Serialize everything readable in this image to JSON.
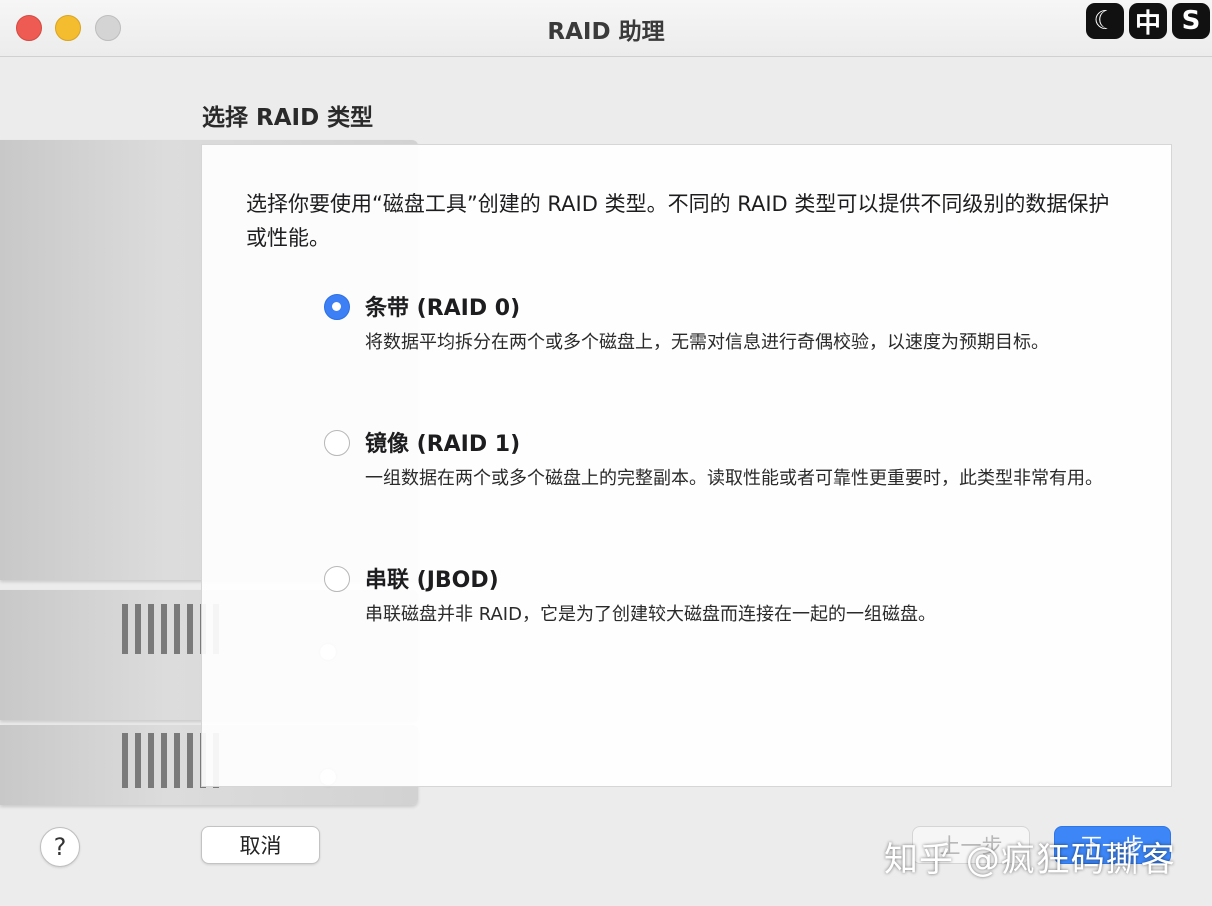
{
  "window": {
    "title": "RAID 助理"
  },
  "badges": [
    "☾",
    "中",
    "S"
  ],
  "heading": "选择 RAID 类型",
  "description": "选择你要使用“磁盘工具”创建的 RAID 类型。不同的 RAID 类型可以提供不同级别的数据保护或性能。",
  "options": [
    {
      "title": "条带 (RAID 0)",
      "desc": "将数据平均拆分在两个或多个磁盘上，无需对信息进行奇偶校验，以速度为预期目标。",
      "selected": true
    },
    {
      "title": "镜像 (RAID 1)",
      "desc": "一组数据在两个或多个磁盘上的完整副本。读取性能或者可靠性更重要时，此类型非常有用。",
      "selected": false
    },
    {
      "title": "串联 (JBOD)",
      "desc": "串联磁盘并非 RAID，它是为了创建较大磁盘而连接在一起的一组磁盘。",
      "selected": false
    }
  ],
  "buttons": {
    "help": "?",
    "cancel": "取消",
    "prev": "上一步",
    "next": "下一步"
  },
  "watermark": "知乎 @疯狂码撕客",
  "colors": {
    "accent": "#3d7ff5",
    "close": "#ee5b52",
    "minimize": "#f4bc2f"
  }
}
